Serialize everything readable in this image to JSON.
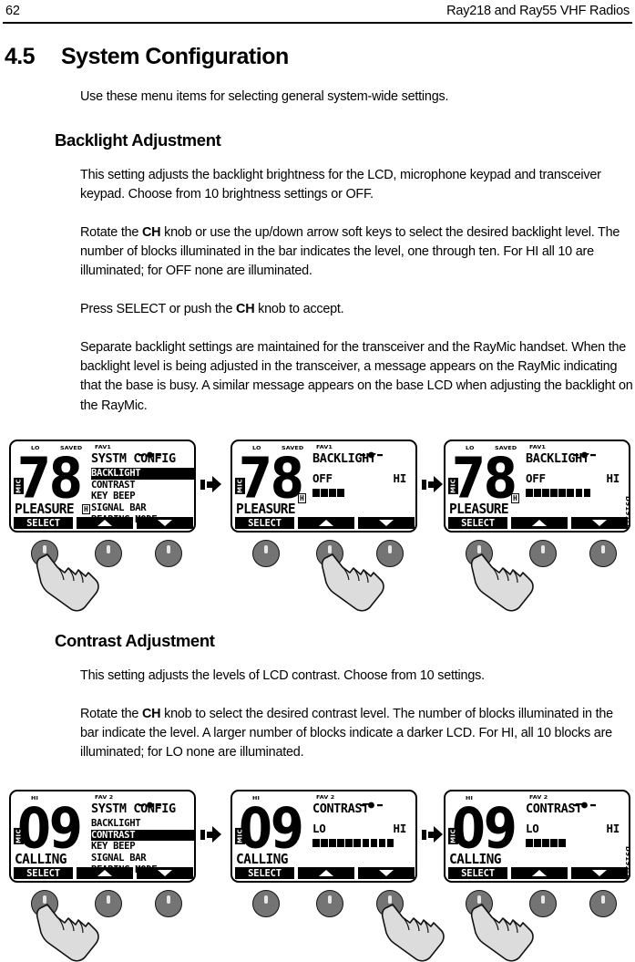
{
  "header": {
    "page_number": "62",
    "doc_title": "Ray218 and Ray55 VHF Radios"
  },
  "section": {
    "number": "4.5",
    "title": "System Configuration",
    "intro": "Use these menu items for selecting general system-wide settings."
  },
  "backlight": {
    "heading": "Backlight Adjustment",
    "p1": "This setting adjusts the backlight brightness for the LCD, microphone keypad and transceiver keypad. Choose from 10 brightness settings or OFF.",
    "p2_a": "Rotate the ",
    "p2_bold": "CH",
    "p2_b": " knob or use the up/down arrow soft keys to select the desired backlight level. The number of blocks illuminated in the bar indicates the level, one through ten. For HI all 10 are illuminated; for OFF none are illuminated.",
    "p3_a": "Press SELECT or push the ",
    "p3_bold": "CH",
    "p3_b": " knob to accept.",
    "p4": "Separate backlight settings are maintained for the transceiver and the RayMic handset. When the backlight level is being adjusted in the transceiver, a message appears on the RayMic indicating that the base is busy. A similar message appears on the base LCD when adjusting the backlight on the RayMic."
  },
  "contrast": {
    "heading": "Contrast Adjustment",
    "p1": "This setting adjusts the levels of LCD contrast. Choose from 10 settings.",
    "p2_a": "Rotate the ",
    "p2_bold": "CH",
    "p2_b": " knob to select the desired contrast level. The number of blocks illuminated in the bar indicate the level. A larger number of blocks indicate a darker LCD. For HI, all 10 blocks are illuminated; for LO none are illuminated."
  },
  "figure_backlight": {
    "id_label": "D9191-1",
    "screens": [
      {
        "name": "systm-config-menu",
        "status_lo": "LO",
        "status_saved": "SAVED",
        "status_fav": "FAV1",
        "channel": "78",
        "mic_badge": "MIC",
        "status_word": "PLEASURE",
        "menu_title": "SYSTM CONFIG",
        "menu_items": [
          "BACKLIGHT",
          "CONTRAST",
          "KEY BEEP",
          "SIGNAL BAR",
          "BEARING MODE"
        ],
        "selected_index": 0,
        "h_marker": "H",
        "softkeys": [
          "SELECT",
          "up-arrow",
          "down-arrow"
        ],
        "show_bar": false,
        "bar_blocks": 0,
        "bar_lo_label": "",
        "bar_hi_label": ""
      },
      {
        "name": "backlight-level-low",
        "status_lo": "LO",
        "status_saved": "SAVED",
        "status_fav": "FAV1",
        "channel": "78",
        "mic_badge": "MIC",
        "status_word": "PLEASURE",
        "menu_title": "BACKLIGHT",
        "menu_items": [],
        "selected_index": -1,
        "h_marker": "H",
        "softkeys": [
          "SELECT",
          "up-arrow",
          "down-arrow"
        ],
        "show_bar": true,
        "bar_blocks": 4,
        "bar_lo_label": "OFF",
        "bar_hi_label": "HI"
      },
      {
        "name": "backlight-level-high",
        "status_lo": "LO",
        "status_saved": "SAVED",
        "status_fav": "FAV1",
        "channel": "78",
        "mic_badge": "MIC",
        "status_word": "PLEASURE",
        "menu_title": "BACKLIGHT",
        "menu_items": [],
        "selected_index": -1,
        "h_marker": "H",
        "softkeys": [
          "SELECT",
          "up-arrow",
          "down-arrow"
        ],
        "show_bar": true,
        "bar_blocks": 8,
        "bar_lo_label": "OFF",
        "bar_hi_label": "HI"
      }
    ],
    "button_groups": [
      {
        "pressed_index": 0
      },
      {
        "pressed_index": 1
      },
      {
        "pressed_index": 0
      }
    ]
  },
  "figure_contrast": {
    "id_label": "D9192-1",
    "screens": [
      {
        "name": "systm-config-menu-contrast",
        "status_lo": "HI",
        "status_saved": "",
        "status_fav": "FAV 2",
        "channel": "09",
        "mic_badge": "MIC",
        "status_word": "CALLING",
        "menu_title": "SYSTM CONFIG",
        "menu_items": [
          "BACKLIGHT",
          "CONTRAST",
          "KEY BEEP",
          "SIGNAL BAR",
          "BEARING MODE"
        ],
        "selected_index": 1,
        "h_marker": "",
        "softkeys": [
          "SELECT",
          "up-arrow",
          "down-arrow"
        ],
        "show_bar": false,
        "bar_blocks": 0,
        "bar_lo_label": "",
        "bar_hi_label": ""
      },
      {
        "name": "contrast-level-high",
        "status_lo": "HI",
        "status_saved": "",
        "status_fav": "FAV 2",
        "channel": "09",
        "mic_badge": "MIC",
        "status_word": "CALLING",
        "menu_title": "CONTRAST",
        "menu_items": [],
        "selected_index": -1,
        "h_marker": "",
        "softkeys": [
          "SELECT",
          "up-arrow",
          "down-arrow"
        ],
        "show_bar": true,
        "bar_blocks": 10,
        "bar_lo_label": "LO",
        "bar_hi_label": "HI"
      },
      {
        "name": "contrast-level-low",
        "status_lo": "HI",
        "status_saved": "",
        "status_fav": "FAV 2",
        "channel": "09",
        "mic_badge": "MIC",
        "status_word": "CALLING",
        "menu_title": "CONTRAST",
        "menu_items": [],
        "selected_index": -1,
        "h_marker": "",
        "softkeys": [
          "SELECT",
          "up-arrow",
          "down-arrow"
        ],
        "show_bar": true,
        "bar_blocks": 5,
        "bar_lo_label": "LO",
        "bar_hi_label": "HI"
      }
    ],
    "button_groups": [
      {
        "pressed_index": 0
      },
      {
        "pressed_index": 2
      },
      {
        "pressed_index": 0
      }
    ]
  }
}
